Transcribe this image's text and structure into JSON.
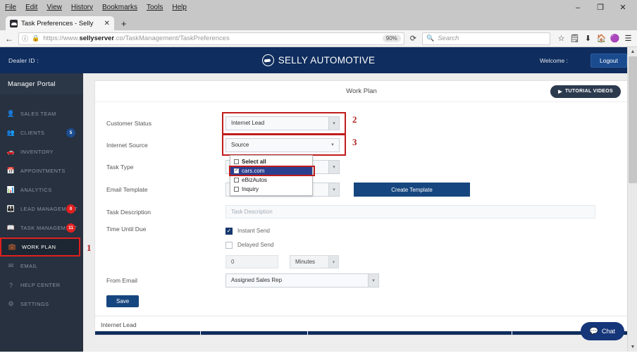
{
  "browser": {
    "menu": [
      "File",
      "Edit",
      "View",
      "History",
      "Bookmarks",
      "Tools",
      "Help"
    ],
    "window_controls": {
      "minimize": "–",
      "maximize": "❐",
      "close": "✕"
    },
    "tab": {
      "title": "Task Preferences - Selly",
      "close": "✕",
      "newtab": "+"
    },
    "nav": {
      "back": "←",
      "forward": "→",
      "info_icon": "ⓘ",
      "lock_icon": "🔒",
      "reload": "⟳"
    },
    "url": {
      "scheme": "https://www.",
      "host_bold": "sellyserver",
      "host_rest": ".co",
      "path": "/TaskManagement/TaskPreferences"
    },
    "zoom_level": "90%",
    "search": {
      "placeholder": "Search",
      "icon": "🔍"
    },
    "toolbar_icons": [
      "star-icon",
      "library-icon",
      "download-icon",
      "home-icon",
      "pocket-icon",
      "menu-icon"
    ]
  },
  "app_header": {
    "dealer_id_label": "Dealer ID :",
    "brand_name": "SELLY AUTOMOTIVE",
    "welcome_label": "Welcome :",
    "logout_label": "Logout"
  },
  "sidebar": {
    "portal_title": "Manager Portal",
    "items": [
      {
        "label": "SALES TEAM",
        "icon": "user-icon",
        "badge": null,
        "active": false
      },
      {
        "label": "CLIENTS",
        "icon": "people-icon",
        "badge": "5",
        "badge_color": "blue",
        "active": false
      },
      {
        "label": "INVENTORY",
        "icon": "car-icon",
        "badge": null,
        "active": false
      },
      {
        "label": "APPOINTMENTS",
        "icon": "calendar-icon",
        "badge": null,
        "active": false
      },
      {
        "label": "ANALYTICS",
        "icon": "bar-chart-icon",
        "badge": null,
        "active": false
      },
      {
        "label": "LEAD MANAGEMENT",
        "icon": "group-icon",
        "badge": "0",
        "badge_color": "red",
        "active": false
      },
      {
        "label": "TASK MANAGEMENT",
        "icon": "book-icon",
        "badge": "11",
        "badge_color": "red",
        "active": false
      },
      {
        "label": "WORK PLAN",
        "icon": "briefcase-icon",
        "badge": null,
        "active": true
      },
      {
        "label": "EMAIL",
        "icon": "envelope-icon",
        "badge": null,
        "active": false
      },
      {
        "label": "HELP CENTER",
        "icon": "question-icon",
        "badge": null,
        "active": false
      },
      {
        "label": "SETTINGS",
        "icon": "gear-icon",
        "badge": null,
        "active": false
      }
    ]
  },
  "markers": {
    "one": "1",
    "two": "2",
    "three": "3"
  },
  "card": {
    "title": "Work Plan",
    "tutorial_button": "TUTORIAL VIDEOS",
    "tutorial_icon": "▶"
  },
  "form": {
    "customer_status": {
      "label": "Customer Status",
      "value": "Internet Lead"
    },
    "internet_source": {
      "label": "Internet Source",
      "value": "Source",
      "options": [
        {
          "label": "Select all",
          "checked": false,
          "bold": true,
          "selected": false
        },
        {
          "label": "cars.com",
          "checked": true,
          "bold": false,
          "selected": true
        },
        {
          "label": "eBizAutos",
          "checked": false,
          "bold": false,
          "selected": false
        },
        {
          "label": "Inquiry",
          "checked": false,
          "bold": false,
          "selected": false
        }
      ]
    },
    "task_type": {
      "label": "Task Type",
      "value": ""
    },
    "email_template": {
      "label": "Email Template",
      "value": "",
      "create_button": "Create Template"
    },
    "task_description": {
      "label": "Task Description",
      "placeholder": "Task Description",
      "value": ""
    },
    "time_until_due": {
      "label": "Time Until Due",
      "instant_send": {
        "label": "Instant Send",
        "checked": true
      },
      "delayed_send": {
        "label": "Delayed Send",
        "checked": false
      },
      "amount": "0",
      "unit": "Minutes"
    },
    "from_email": {
      "label": "From Email",
      "value": "Assigned Sales Rep"
    },
    "save_button": "Save"
  },
  "bottom_section": {
    "label": "Internet Lead"
  },
  "chat": {
    "label": "Chat",
    "icon": "💬"
  },
  "colors": {
    "brand_navy": "#0f2d5e",
    "sidebar_dark": "#27313f",
    "accent_red": "#e02020",
    "highlight_box": "#c01c1c",
    "button_blue": "#16467f",
    "dropdown_select": "#2b3f8f"
  }
}
